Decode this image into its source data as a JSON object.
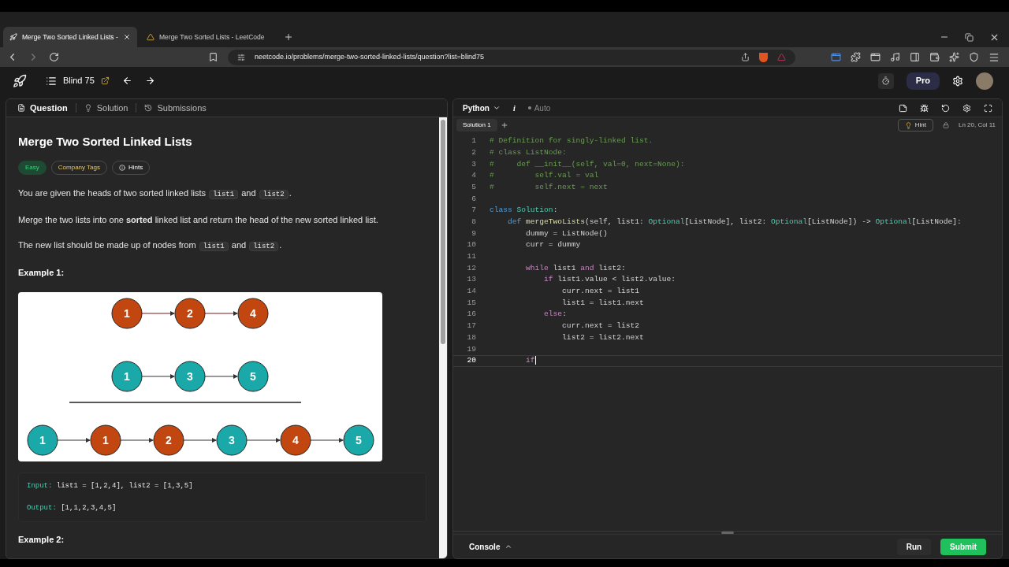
{
  "browser": {
    "tabs": [
      {
        "title": "Merge Two Sorted Linked Lists -",
        "selected": true
      },
      {
        "title": "Merge Two Sorted Lists - LeetCode",
        "selected": false
      }
    ],
    "url": "neetcode.io/problems/merge-two-sorted-linked-lists/question?list=blind75"
  },
  "header": {
    "list_title": "Blind 75",
    "pro": "Pro"
  },
  "question": {
    "tabs": [
      {
        "label": "Question",
        "selected": true
      },
      {
        "label": "Solution",
        "selected": false
      },
      {
        "label": "Submissions",
        "selected": false
      }
    ],
    "title": "Merge Two Sorted Linked Lists",
    "tags": [
      {
        "label": "Easy",
        "kind": "difficulty"
      },
      {
        "label": "Company Tags",
        "kind": "company"
      },
      {
        "label": "Hints",
        "kind": "hints"
      }
    ],
    "paragraphs": [
      [
        {
          "kind": "text",
          "text": "You are given the heads of two sorted linked lists "
        },
        {
          "kind": "code",
          "text": "list1"
        },
        {
          "kind": "text",
          "text": " and "
        },
        {
          "kind": "code",
          "text": "list2"
        },
        {
          "kind": "text",
          "text": "."
        }
      ],
      [
        {
          "kind": "text",
          "text": "Merge the two lists into one **sorted** linked list and return the head of the new sorted linked list."
        }
      ],
      [
        {
          "kind": "text",
          "text": "The new list should be made up of nodes from "
        },
        {
          "kind": "code",
          "text": "list1"
        },
        {
          "kind": "text",
          "text": " and "
        },
        {
          "kind": "code",
          "text": "list2"
        },
        {
          "kind": "text",
          "text": "."
        }
      ]
    ],
    "example1": {
      "heading": "Example 1:",
      "diagram": {
        "rows": [
          [
            {
              "value": "1",
              "color": "#c2460f"
            },
            {
              "value": "2",
              "color": "#c2460f"
            },
            {
              "value": "4",
              "color": "#c2460f"
            }
          ],
          [
            {
              "value": "1",
              "color": "#1aa8a8"
            },
            {
              "value": "3",
              "color": "#1aa8a8"
            },
            {
              "value": "5",
              "color": "#1aa8a8"
            }
          ],
          [
            {
              "value": "1",
              "color": "#1aa8a8"
            },
            {
              "value": "1",
              "color": "#c2460f"
            },
            {
              "value": "2",
              "color": "#c2460f"
            },
            {
              "value": "3",
              "color": "#1aa8a8"
            },
            {
              "value": "4",
              "color": "#c2460f"
            },
            {
              "value": "5",
              "color": "#1aa8a8"
            }
          ]
        ]
      },
      "io": [
        {
          "label": "Input:",
          "value": " list1 = [1,2,4], list2 = [1,3,5]"
        },
        {
          "label": "Output:",
          "value": " [1,1,2,3,4,5]"
        }
      ]
    },
    "example2": {
      "heading": "Example 2:"
    }
  },
  "editor": {
    "language": "Python",
    "info_label": "i",
    "mode": "Auto",
    "file_tab": "Solution 1",
    "hint": "Hint",
    "position": "Ln 20, Col 11",
    "lines": [
      {
        "number": "1",
        "current": false,
        "segments": [
          {
            "kind": "comment",
            "text": "# Definition for singly-linked list."
          }
        ]
      },
      {
        "number": "2",
        "current": false,
        "segments": [
          {
            "kind": "comment",
            "text": "# class ListNode:"
          }
        ]
      },
      {
        "number": "3",
        "current": false,
        "segments": [
          {
            "kind": "comment",
            "text": "#     def __init__(self, val=0, next=None):"
          }
        ]
      },
      {
        "number": "4",
        "current": false,
        "segments": [
          {
            "kind": "comment",
            "text": "#         self.val = val"
          }
        ]
      },
      {
        "number": "5",
        "current": false,
        "segments": [
          {
            "kind": "comment",
            "text": "#         self.next = next"
          }
        ]
      },
      {
        "number": "6",
        "current": false
      },
      {
        "number": "7",
        "current": false,
        "segments": [
          {
            "kind": "keyword",
            "text": "class"
          },
          {
            "kind": "type",
            "text": " Solution"
          },
          {
            "kind": "plain",
            "text": ":"
          }
        ]
      },
      {
        "number": "8",
        "current": false,
        "segments": [
          {
            "kind": "keyword",
            "text": "    def"
          },
          {
            "kind": "function",
            "text": " mergeTwoLists"
          },
          {
            "kind": "plain",
            "text": "(self, list1: "
          },
          {
            "kind": "type",
            "text": "Optional"
          },
          {
            "kind": "plain",
            "text": "[ListNode], list2: "
          },
          {
            "kind": "type",
            "text": "Optional"
          },
          {
            "kind": "plain",
            "text": "[ListNode]) -> "
          },
          {
            "kind": "type",
            "text": "Optional"
          },
          {
            "kind": "plain",
            "text": "[ListNode]:"
          }
        ]
      },
      {
        "number": "9",
        "current": false,
        "segments": [
          {
            "kind": "plain",
            "text": "        dummy = ListNode()"
          }
        ]
      },
      {
        "number": "10",
        "current": false,
        "segments": [
          {
            "kind": "plain",
            "text": "        curr = dummy"
          }
        ]
      },
      {
        "number": "11",
        "current": false
      },
      {
        "number": "12",
        "current": false,
        "segments": [
          {
            "kind": "control",
            "text": "        while"
          },
          {
            "kind": "plain",
            "text": " list1 "
          },
          {
            "kind": "control",
            "text": "and"
          },
          {
            "kind": "plain",
            "text": " list2:"
          }
        ]
      },
      {
        "number": "13",
        "current": false,
        "segments": [
          {
            "kind": "control",
            "text": "            if"
          },
          {
            "kind": "plain",
            "text": " list1.value < list2.value:"
          }
        ]
      },
      {
        "number": "14",
        "current": false,
        "segments": [
          {
            "kind": "plain",
            "text": "                curr.next = list1"
          }
        ]
      },
      {
        "number": "15",
        "current": false,
        "segments": [
          {
            "kind": "plain",
            "text": "                list1 = list1.next"
          }
        ]
      },
      {
        "number": "16",
        "current": false,
        "segments": [
          {
            "kind": "control",
            "text": "            else"
          },
          {
            "kind": "plain",
            "text": ":"
          }
        ]
      },
      {
        "number": "17",
        "current": false,
        "segments": [
          {
            "kind": "plain",
            "text": "                curr.next = list2"
          }
        ]
      },
      {
        "number": "18",
        "current": false,
        "segments": [
          {
            "kind": "plain",
            "text": "                list2 = list2.next"
          }
        ]
      },
      {
        "number": "19",
        "current": false
      },
      {
        "number": "20",
        "current": true,
        "segments": [
          {
            "kind": "control",
            "text": "        if"
          }
        ]
      }
    ]
  },
  "console": {
    "label": "Console",
    "run": "Run",
    "submit": "Submit"
  }
}
